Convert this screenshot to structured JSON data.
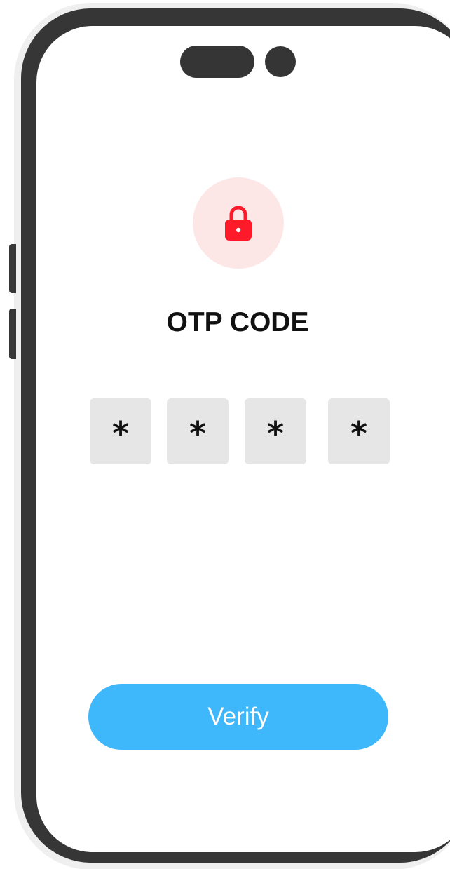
{
  "screen": {
    "title": "OTP CODE",
    "icon": "lock-icon",
    "accent_color": "#ff1a2a",
    "icon_bg_color": "#fde6e6"
  },
  "otp": {
    "digits": [
      "*",
      "*",
      "*",
      "*"
    ]
  },
  "actions": {
    "verify_label": "Verify",
    "verify_color": "#3fb8fb"
  }
}
